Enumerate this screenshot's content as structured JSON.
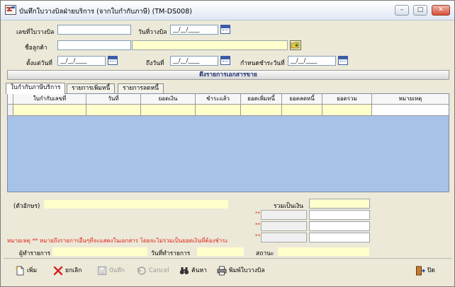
{
  "window": {
    "title": "บันทึกใบวางบิลฝ่ายบริการ  (จากใบกำกับภาษี) (TM-DS008)",
    "controls": {
      "minimize": "–",
      "maximize": "□",
      "close": "✕"
    }
  },
  "form": {
    "bill_no_label": "เลขที่ใบวางบิล",
    "bill_no_value": "",
    "bill_date_label": "วันที่วางบิล",
    "bill_date_value": "__/__/____",
    "customer_label": "ชื่อลูกค้า",
    "customer_code_value": "",
    "customer_name_value": "",
    "from_date_label": "ตั้งแต่วันที่",
    "from_date_value": "__/__/____",
    "to_date_label": "ถึงวันที่",
    "to_date_value": "__/__/____",
    "due_date_label": "กำหนดชำระวันที่",
    "due_date_value": "__/__/____"
  },
  "section": {
    "fetch_items_label": "ดึงรายการเอกสารขาย"
  },
  "tabs": [
    {
      "label": "ใบกำกับภาษีบริการ"
    },
    {
      "label": "รายการเพิ่มหนี้"
    },
    {
      "label": "รายการลดหนี้"
    }
  ],
  "grid": {
    "columns": [
      "ใบกำกับเลขที่",
      "วันที่",
      "ยอดเงิน",
      "ชำระแล้ว",
      "ยอดเพิ่มหนี้",
      "ยอดลดหนี้",
      "ยอดรวม",
      "หมายเหตุ"
    ]
  },
  "summary": {
    "text_amount_label": "(ตัวอักษร)",
    "text_amount_value": "",
    "total_label": "รวมเป็นเงิน",
    "total_value": "",
    "star_mark": "**",
    "note_text": "หมายเหตุ  ** หมายถึงรายการอื่นๆที่จะแสดงในเอกสาร โดยจะไม่รวมเป็นยอดเงินที่ต้องชำระ",
    "operator_label": "ผู้ทำรายการ",
    "operator_value": "",
    "op_date_label": "วันที่ทำรายการ",
    "op_date_value": "",
    "status_label": "สถานะ",
    "status_value": ""
  },
  "toolbar": {
    "add": "เพิ่ม",
    "cancel_th": "ยกเลิก",
    "save": "บันทึก",
    "cancel_en": "Cancel",
    "search": "ค้นหา",
    "print": "พิมพ์ใบวางบิล",
    "close": "ปิด"
  }
}
